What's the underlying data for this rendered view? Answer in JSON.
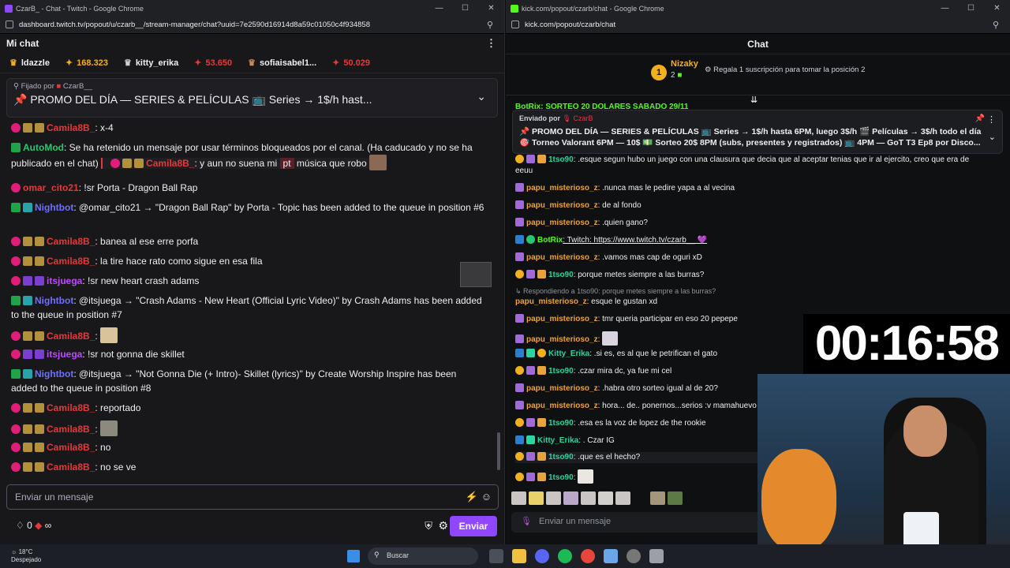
{
  "left": {
    "window_title": "CzarB_ - Chat - Twitch - Google Chrome",
    "url": "dashboard.twitch.tv/popout/u/czarb__/stream-manager/chat?uuid=7e2590d16914d8a59c01050c4f934858",
    "chat_title": "Mi chat",
    "leaders": [
      {
        "name": "ldazzle",
        "color": "#efeff1"
      },
      {
        "name": "168.323",
        "color": "#f2b01e"
      },
      {
        "name": "kitty_erika",
        "color": "#efeff1"
      },
      {
        "name": "53.650",
        "color": "#e23a3a"
      },
      {
        "name": "sofiaisabel1...",
        "color": "#efeff1"
      },
      {
        "name": "50.029",
        "color": "#e23a3a"
      }
    ],
    "pinned_by": "Fijado por",
    "pinned_user": "CzarB__",
    "pinned_text": "📌 PROMO DEL DÍA — SERIES & PELÍCULAS 📺 Series → 1$/h hast...",
    "messages": [
      {
        "user": "Camila8B_",
        "text": ": x-4"
      },
      {
        "user": "AutoMod",
        "text": ": Se ha retenido un mensaje por usar términos bloqueados por el canal. (Ha caducado y no se ha publicado en el chat)"
      },
      {
        "user2": "Camila8B_",
        "text2": ": y aun no suena mi",
        "tag": "pt",
        "text3": "música que robo"
      },
      {
        "user": "omar_cito21",
        "text": ": !sr Porta - Dragon Ball Rap"
      },
      {
        "user": "Nightbot",
        "text": ": @omar_cito21 → \"Dragon Ball Rap\" by Porta - Topic has been added to the queue in position #6"
      },
      {
        "user": "Camila8B_",
        "text": ": banea al ese erre porfa"
      },
      {
        "user": "Camila8B_",
        "text": ": la tire hace rato como sigue en esa fila"
      },
      {
        "user": "itsjuega",
        "text": ": !sr new heart crash adams"
      },
      {
        "user": "Nightbot",
        "text": ": @itsjuega → \"Crash Adams - New Heart (Official Lyric Video)\" by Crash Adams has been added to the queue in position #7"
      },
      {
        "user": "Camila8B_",
        "text": ":"
      },
      {
        "user": "itsjuega",
        "text": ": !sr not gonna die skillet"
      },
      {
        "user": "Nightbot",
        "text": ": @itsjuega → \"Not Gonna Die (+ Intro)- Skillet (lyrics)\" by Create Worship Inspire has been added to the queue in position #8"
      },
      {
        "user": "Camila8B_",
        "text": ": reportado"
      },
      {
        "user": "Camila8B_",
        "text": ":"
      },
      {
        "user": "Camila8B_",
        "text": ": no"
      },
      {
        "user": "Camila8B_",
        "text": ": no se ve"
      }
    ],
    "input_placeholder": "Enviar un mensaje",
    "points": "0",
    "infinity": "∞",
    "send_label": "Enviar"
  },
  "right": {
    "window_title": "kick.com/popout/czarb/chat - Google Chrome",
    "url": "kick.com/popout/czarb/chat",
    "chat_title": "Chat",
    "top_rank": "1",
    "top_name": "Nizaky",
    "top_count": "2",
    "gift_text": "Regala 1 suscripción para tomar la posición 2",
    "pinned_by": "Enviado por",
    "pinned_user": "CzarB",
    "pinned_line1": "📌 PROMO DEL DÍA — SERIES & PELÍCULAS 📺 Series → 1$/h hasta 6PM, luego 3$/h 🎬 Películas → 3$/h todo el día",
    "pinned_line2": "🎯 Torneo Valorant 6PM — 10$ 💵 Sorteo 20$ 8PM (subs, presentes y registrados) 📺 4PM — GoT T3 Ep8 por Disco...",
    "behind_text": "BotRix: SORTEO 20 DOLARES SABADO 29/11",
    "messages": [
      {
        "user": "1tso90",
        "text": ": .esque segun hubo un juego con una clausura que decia que al aceptar tenias que ir al ejercito, creo que era de eeuu"
      },
      {
        "user": "papu_misterioso_z",
        "text": ": .nunca mas le pedire yapa a al vecina"
      },
      {
        "user": "papu_misterioso_z",
        "text": ": de al fondo"
      },
      {
        "user": "papu_misterioso_z",
        "text": ": .quien gano?"
      },
      {
        "user": "BotRix",
        "text": ": Twitch: https://www.twitch.tv/czarb__ 💜"
      },
      {
        "user": "papu_misterioso_z",
        "text": ": .vamos mas cap de oguri xD"
      },
      {
        "user": "1tso90",
        "text": ": porque metes siempre a las burras?"
      },
      {
        "reply": "↳ Respondiendo a 1tso90: porque metes siempre a las burras?"
      },
      {
        "user": "papu_misterioso_z",
        "text": ": esque le gustan xd"
      },
      {
        "user": "papu_misterioso_z",
        "text": ": tmr queria participar en eso 20 pepepe"
      },
      {
        "user": "papu_misterioso_z",
        "text": ":"
      },
      {
        "user": "Kitty_Erika",
        "text": ": .si es, es al que le petrifican el gato"
      },
      {
        "user": "1tso90",
        "text": ": .czar mira dc, ya fue mi cel"
      },
      {
        "user": "papu_misterioso_z",
        "text": ": .habra otro sorteo igual al de 20?"
      },
      {
        "user": "papu_misterioso_z",
        "text": ": hora... de.. ponernos...serios :v mamahuevo"
      },
      {
        "user": "1tso90",
        "text": ": .esa es la voz de lopez de the rookie"
      },
      {
        "user": "Kitty_Erika",
        "text": ": . Czar IG"
      },
      {
        "user": "1tso90",
        "text": ": .que es el hecho?"
      },
      {
        "user": "1tso90",
        "text": ":"
      }
    ],
    "input_placeholder": "Enviar un mensaje"
  },
  "timer": "00:16:58",
  "taskbar": {
    "temp": "18°C",
    "weather": "Despejado",
    "search": "Buscar"
  }
}
